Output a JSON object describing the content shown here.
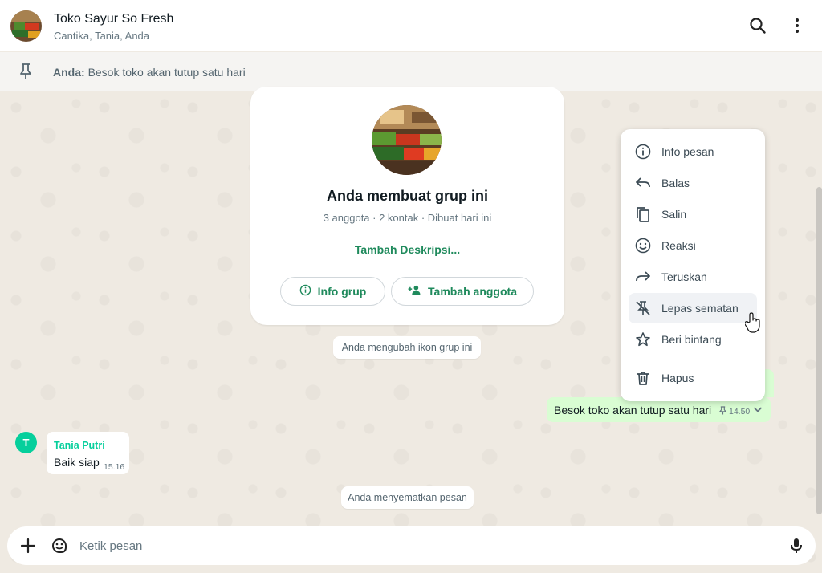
{
  "header": {
    "title": "Toko Sayur So Fresh",
    "subtitle": "Cantika, Tania, Anda",
    "search_icon": "search-icon",
    "menu_icon": "kebab-menu-icon"
  },
  "pinned": {
    "sender": "Anda:",
    "text": "Besok toko akan tutup satu hari",
    "icon": "pin-icon"
  },
  "group_card": {
    "title": "Anda membuat grup ini",
    "subtitle": "3 anggota · 2 kontak · Dibuat hari ini",
    "add_description": "Tambah Deskripsi...",
    "info_button": "Info grup",
    "add_member_button": "Tambah anggota"
  },
  "system_messages": {
    "icon_changed": "Anda mengubah ikon grup ini",
    "pinned_message": "Anda menyematkan pesan"
  },
  "outgoing_message": {
    "text": "Besok toko akan tutup satu hari",
    "time": "14.50"
  },
  "incoming_message": {
    "avatar_letter": "T",
    "sender": "Tania Putri",
    "text": "Baik siap",
    "time": "15.16"
  },
  "context_menu": {
    "items": [
      {
        "label": "Info pesan",
        "icon": "info-icon"
      },
      {
        "label": "Balas",
        "icon": "reply-icon"
      },
      {
        "label": "Salin",
        "icon": "copy-icon"
      },
      {
        "label": "Reaksi",
        "icon": "emoji-icon"
      },
      {
        "label": "Teruskan",
        "icon": "forward-icon"
      },
      {
        "label": "Lepas sematan",
        "icon": "unpin-icon"
      },
      {
        "label": "Beri bintang",
        "icon": "star-icon"
      },
      {
        "label": "Hapus",
        "icon": "trash-icon"
      }
    ]
  },
  "composer": {
    "placeholder": "Ketik pesan"
  },
  "colors": {
    "accent": "#1f8a5c",
    "outgoing_bubble": "#d9fdd3",
    "chat_background": "#efeae2",
    "sender_name": "#06cf9c"
  }
}
